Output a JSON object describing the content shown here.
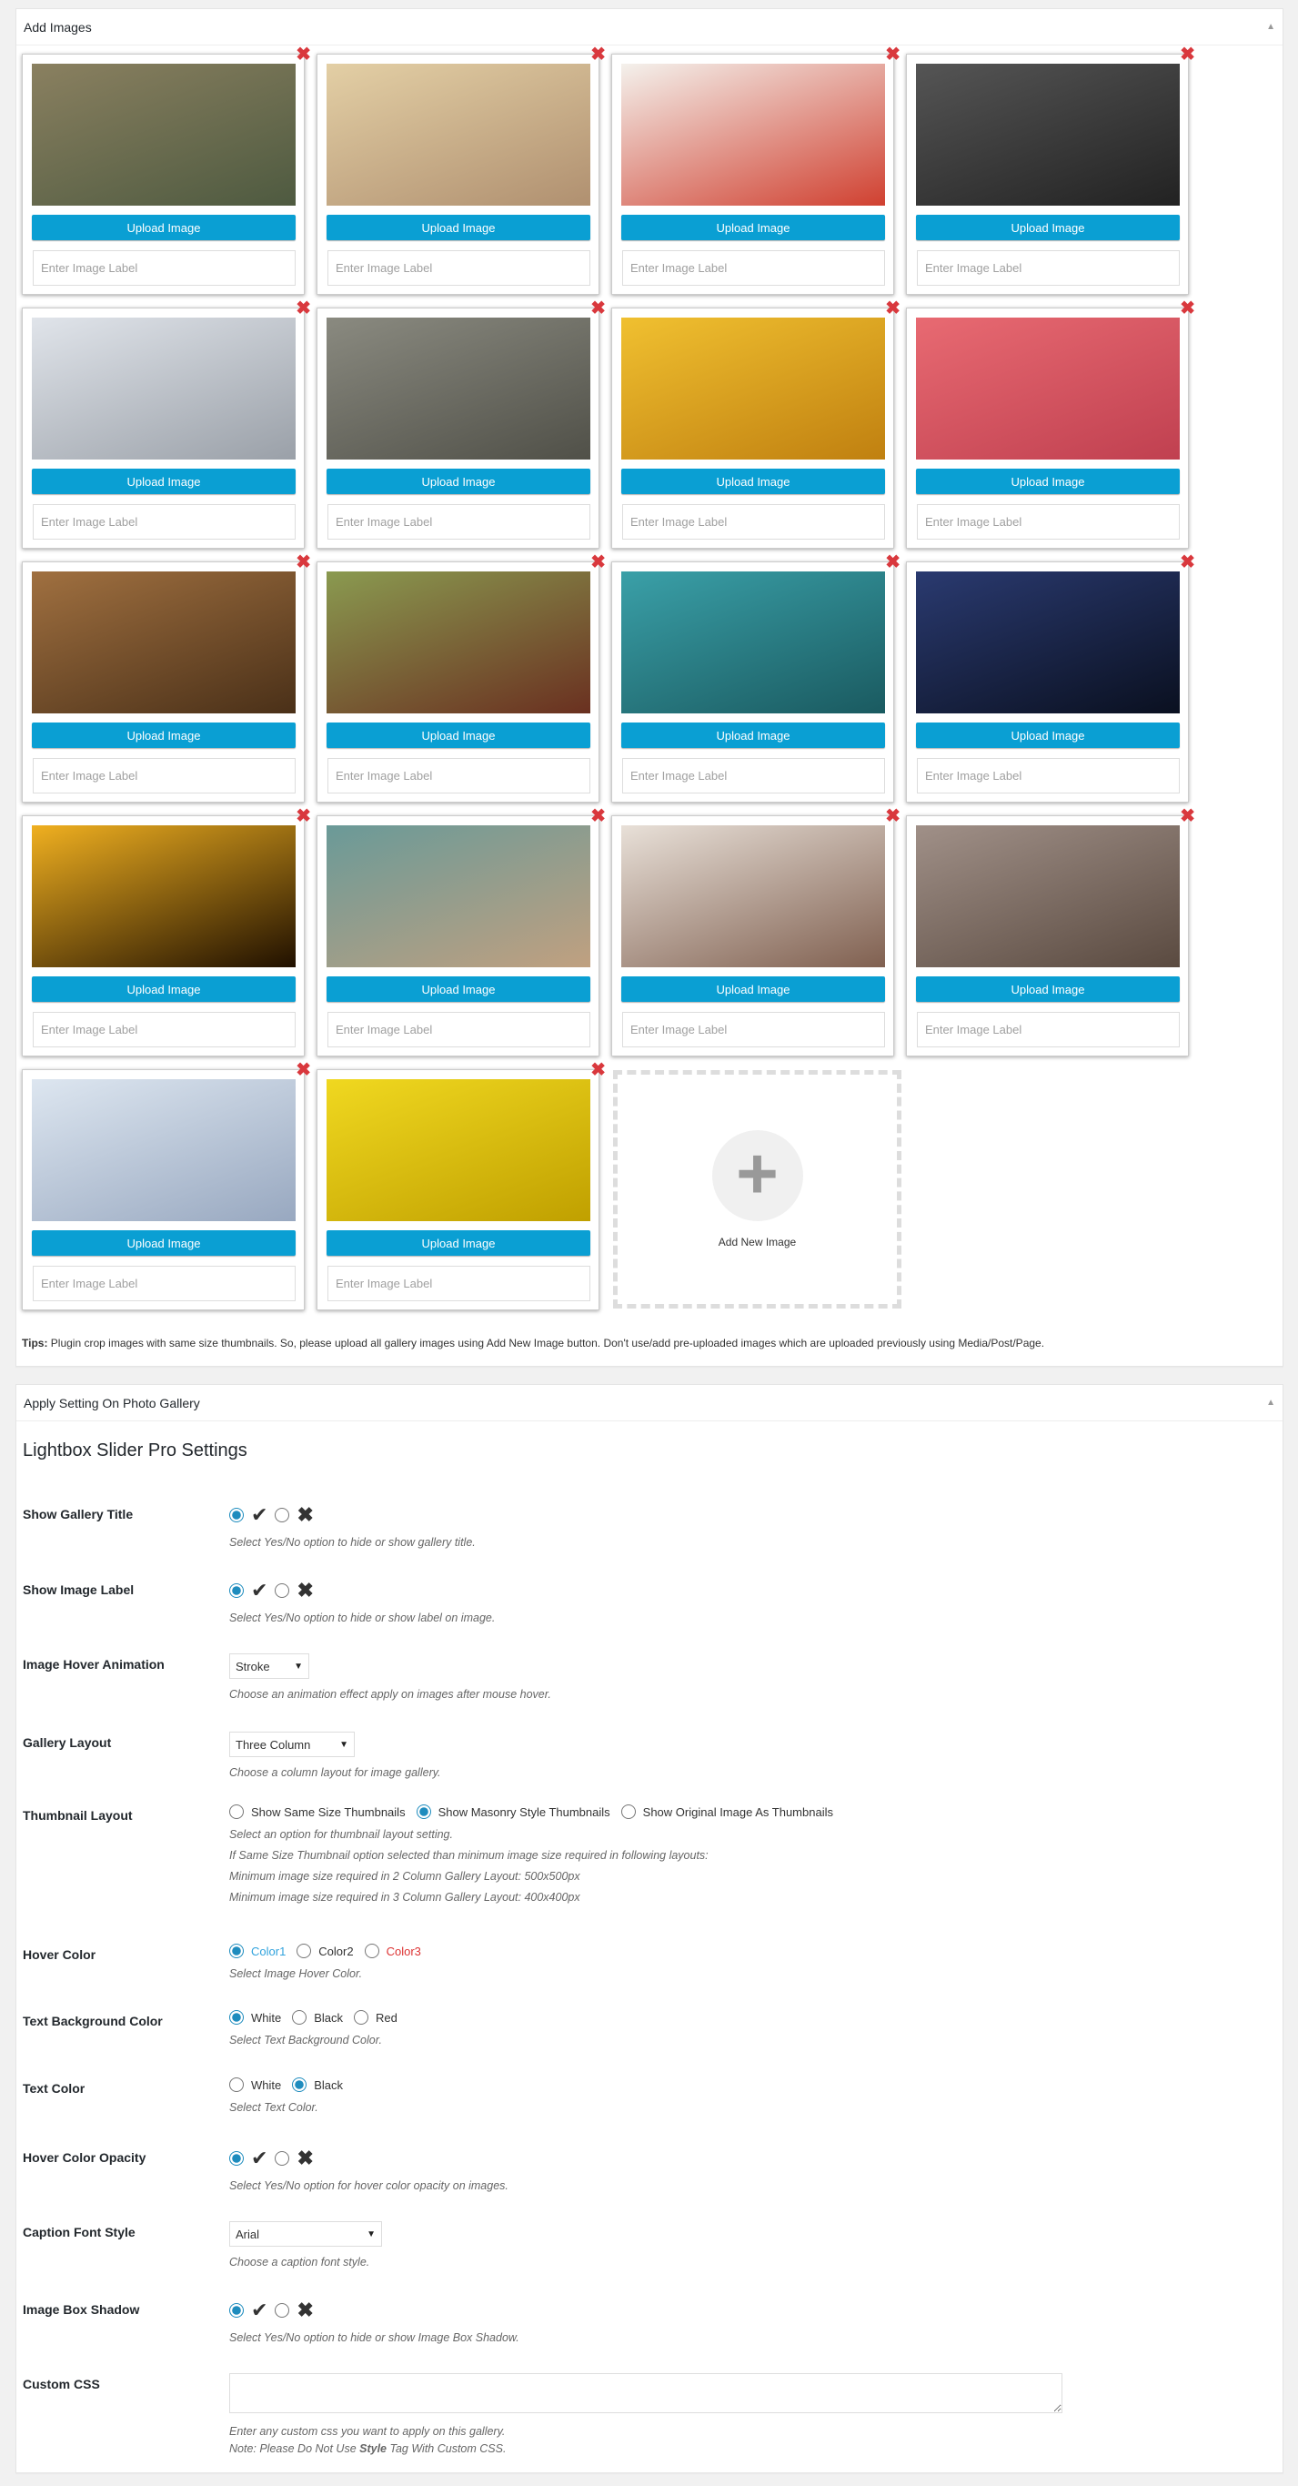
{
  "gallery": {
    "title": "Add Images",
    "upload_label": "Upload Image",
    "label_placeholder": "Enter Image Label",
    "images": [
      {
        "thumb_color": [
          "#8a8060",
          "#4e5a40"
        ]
      },
      {
        "thumb_color": [
          "#e3cfa5",
          "#b09070"
        ]
      },
      {
        "thumb_color": [
          "#f4f1ec",
          "#d04030"
        ]
      },
      {
        "thumb_color": [
          "#555",
          "#222"
        ]
      },
      {
        "thumb_color": [
          "#e0e4ea",
          "#9aa0a8"
        ]
      },
      {
        "thumb_color": [
          "#8a8a80",
          "#505048"
        ]
      },
      {
        "thumb_color": [
          "#f0c030",
          "#c08010"
        ]
      },
      {
        "thumb_color": [
          "#e86a72",
          "#c04050"
        ]
      },
      {
        "thumb_color": [
          "#a07040",
          "#4a3018"
        ]
      },
      {
        "thumb_color": [
          "#8a9a50",
          "#6a3020"
        ]
      },
      {
        "thumb_color": [
          "#3aa0a8",
          "#1a5a60"
        ]
      },
      {
        "thumb_color": [
          "#2a3a70",
          "#0a1020"
        ]
      },
      {
        "thumb_color": [
          "#f0b020",
          "#201000"
        ]
      },
      {
        "thumb_color": [
          "#6a9a98",
          "#c0a080"
        ]
      },
      {
        "thumb_color": [
          "#e8e0d8",
          "#806050"
        ]
      },
      {
        "thumb_color": [
          "#a09088",
          "#5a4a40"
        ]
      },
      {
        "thumb_color": [
          "#dde6f0",
          "#98a8c0"
        ]
      },
      {
        "thumb_color": [
          "#f0d820",
          "#c0a000"
        ]
      }
    ],
    "add_new_label": "Add New Image",
    "tips_label": "Tips:",
    "tips_text": " Plugin crop images with same size thumbnails. So, please upload all gallery images using Add New Image button. Don't use/add pre-uploaded images which are uploaded previously using Media/Post/Page."
  },
  "settings": {
    "panel_title": "Apply Setting On Photo Gallery",
    "heading": "Lightbox Slider Pro Settings",
    "show_gallery_title": {
      "label": "Show Gallery Title",
      "desc": "Select Yes/No option to hide or show gallery title.",
      "value": "yes"
    },
    "show_image_label": {
      "label": "Show Image Label",
      "desc": "Select Yes/No option to hide or show label on image.",
      "value": "yes"
    },
    "hover_animation": {
      "label": "Image Hover Animation",
      "value": "Stroke",
      "desc": "Choose an animation effect apply on images after mouse hover."
    },
    "gallery_layout": {
      "label": "Gallery Layout",
      "value": "Three Column",
      "desc": "Choose a column layout for image gallery."
    },
    "thumbnail_layout": {
      "label": "Thumbnail Layout",
      "options": [
        "Show Same Size Thumbnails",
        "Show Masonry Style Thumbnails",
        "Show Original Image As Thumbnails"
      ],
      "selected": 1,
      "desc": [
        "Select an option for thumbnail layout setting.",
        "If Same Size Thumbnail option selected than minimum image size required in following layouts:",
        "Minimum image size required in 2 Column Gallery Layout: 500x500px",
        "Minimum image size required in 3 Column Gallery Layout: 400x400px"
      ]
    },
    "hover_color": {
      "label": "Hover Color",
      "options": [
        "Color1",
        "Color2",
        "Color3"
      ],
      "option_colors": [
        "#31a3dd",
        "#333333",
        "#dd3333"
      ],
      "selected": 0,
      "desc": "Select Image Hover Color."
    },
    "text_bg_color": {
      "label": "Text Background Color",
      "options": [
        "White",
        "Black",
        "Red"
      ],
      "selected": 0,
      "desc": "Select Text Background Color."
    },
    "text_color": {
      "label": "Text Color",
      "options": [
        "White",
        "Black"
      ],
      "selected": 1,
      "desc": "Select Text Color."
    },
    "hover_opacity": {
      "label": "Hover Color Opacity",
      "desc": "Select Yes/No option for hover color opacity on images.",
      "value": "yes"
    },
    "caption_font": {
      "label": "Caption Font Style",
      "value": "Arial",
      "desc": "Choose a caption font style."
    },
    "box_shadow": {
      "label": "Image Box Shadow",
      "desc": "Select Yes/No option to hide or show Image Box Shadow.",
      "value": "yes"
    },
    "custom_css": {
      "label": "Custom CSS",
      "value": "",
      "desc1": "Enter any custom css you want to apply on this gallery.",
      "desc2_pre": "Note: Please Do Not Use ",
      "desc2_bold": "Style",
      "desc2_post": " Tag With Custom CSS."
    }
  }
}
